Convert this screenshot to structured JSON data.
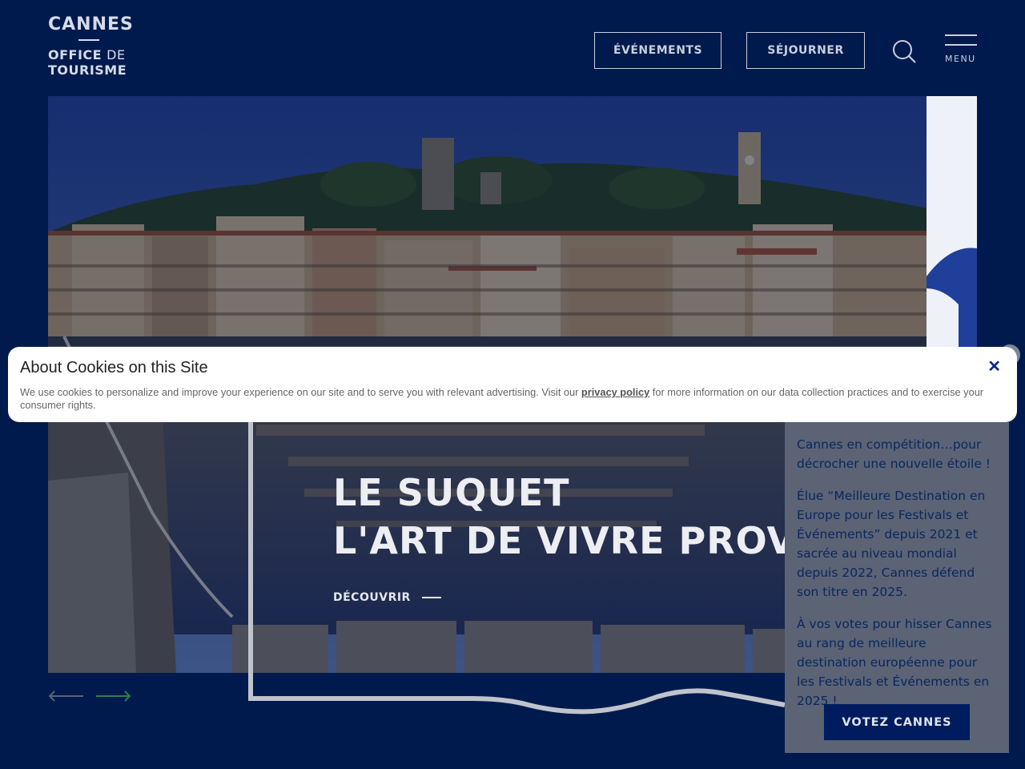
{
  "logo": {
    "line1": "CANNES",
    "line2_bold": "OFFICE",
    "line2_light": "DE",
    "line3": "TOURISME"
  },
  "header": {
    "events_label": "ÉVÉNEMENTS",
    "stay_label": "SÉJOURNER",
    "menu_label": "MENU"
  },
  "hero": {
    "title_line1": "LE SUQUET",
    "title_line2": "L'ART DE VIVRE PROVE",
    "cta_label": "DÉCOUVRIR"
  },
  "vote_panel": {
    "paragraphs": [
      "Cannes en compétition…pour décrocher une nouvelle étoile !",
      "Élue “Meilleure Destination en Europe pour les Festivals et Événements” depuis 2021 et sacrée au niveau mondial depuis 2022, Cannes défend son titre en 2025.",
      "À vos votes pour hisser Cannes au rang de meilleure destination européenne pour les Festivals et Événements en 2025 !"
    ],
    "button_label": "VOTEZ CANNES"
  },
  "cookie": {
    "title": "About Cookies on this Site",
    "text_before": "We use cookies to personalize and improve your experience on our site and to serve you with relevant advertising. Visit our ",
    "link_text": "privacy policy",
    "text_after": " for more information on our data collection practices and to exercise your consumer rights.",
    "close_symbol": "✕"
  },
  "icons": {
    "search": "search-icon",
    "menu": "hamburger-icon",
    "prev": "arrow-left-icon",
    "next": "arrow-right-icon"
  },
  "colors": {
    "page_bg": "#001a4d",
    "button_navy": "#001c5f",
    "panel_bg": "#5b6374",
    "next_arrow": "#2e7d4f"
  }
}
